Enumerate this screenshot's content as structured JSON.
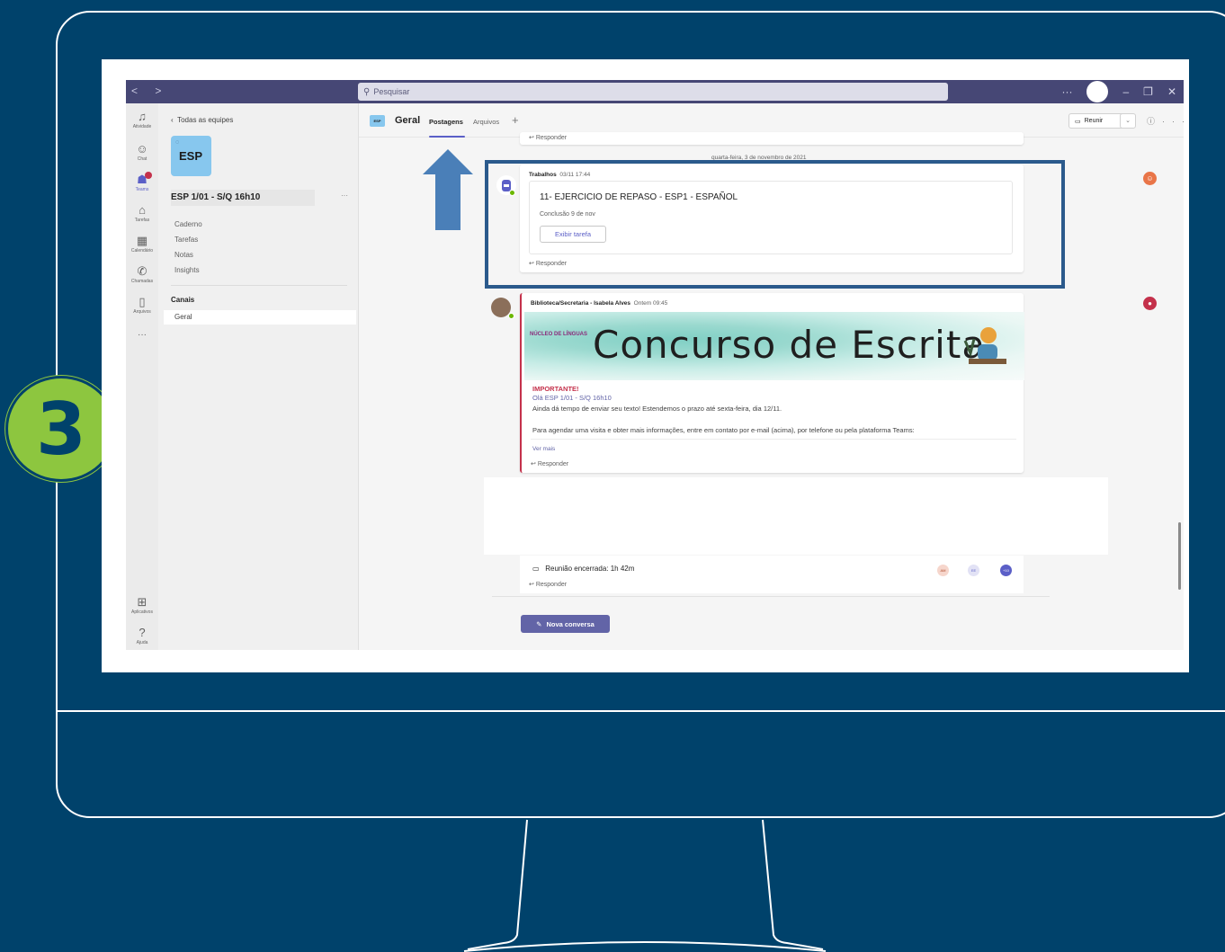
{
  "step": {
    "number": "3",
    "color": "#8DC63F"
  },
  "titlebar": {
    "nav_back": "<",
    "nav_forward": ">",
    "search_placeholder": "Pesquisar",
    "more": "···",
    "minimize": "–",
    "maximize": "❐",
    "close": "✕"
  },
  "rail": [
    {
      "label": "Atividade",
      "icon": "bell-icon"
    },
    {
      "label": "Chat",
      "icon": "chat-icon"
    },
    {
      "label": "Teams",
      "icon": "teams-icon"
    },
    {
      "label": "Tarefas",
      "icon": "backpack-icon"
    },
    {
      "label": "Calendário",
      "icon": "calendar-icon"
    },
    {
      "label": "Chamadas",
      "icon": "phone-icon"
    },
    {
      "label": "Arquivos",
      "icon": "file-icon"
    },
    {
      "label": "Aplicativos",
      "icon": "apps-icon"
    },
    {
      "label": "Ajuda",
      "icon": "help-icon"
    }
  ],
  "rail_more": "···",
  "team_panel": {
    "back_label": "Todas as equipes",
    "team_logo_text": "ESP",
    "team_name": "ESP 1/01 - S/Q 16h10",
    "more": "···",
    "items": [
      "Caderno",
      "Tarefas",
      "Notas",
      "Insights"
    ],
    "channels_heading": "Canais",
    "channels": [
      "Geral"
    ]
  },
  "channel_header": {
    "logo_text": "ESP",
    "title": "Geral",
    "tabs": [
      "Postagens",
      "Arquivos"
    ],
    "add_tab": "+",
    "meet_button": "Reunir",
    "info": "ⓘ",
    "more": "···"
  },
  "feed": {
    "reply_label": "Responder",
    "date_divider": "quarta-feira, 3 de novembro de 2021",
    "assignment_post": {
      "author": "Trabalhos",
      "time": "03/11 17:44",
      "title": "11- EJERCICIO DE REPASO - ESP1 - ESPAÑOL",
      "due": "Conclusão 9 de nov",
      "button": "Exibir tarefa"
    },
    "library_post": {
      "author": "Biblioteca/Secretaria - Isabela Alves",
      "time": "Ontem 09:45",
      "banner_logo": "NÚCLEO DE LÍNGUAS",
      "banner_title": "Concurso de Escrita",
      "important": "IMPORTANTE!",
      "greeting": "Olá ESP 1/01 - S/Q 16h10",
      "line1": "Ainda dá tempo de enviar seu texto! Estendemos o prazo até sexta-feira, dia 12/11.",
      "line2": "Para agendar uma visita e obter mais informações, entre em contato por e-mail (acima), por telefone ou pela plataforma Teams:",
      "see_more": "Ver mais"
    },
    "meeting_post": {
      "text": "Reunião encerrada: 1h 42m",
      "participants": [
        "AM",
        "EE",
        "+10"
      ]
    },
    "new_conversation": "Nova conversa"
  },
  "colors": {
    "background": "#00426B",
    "teams_purple": "#6264A7",
    "titlebar": "#464775",
    "highlight": "#2B5A8C",
    "arrow": "#4A7FB8"
  }
}
